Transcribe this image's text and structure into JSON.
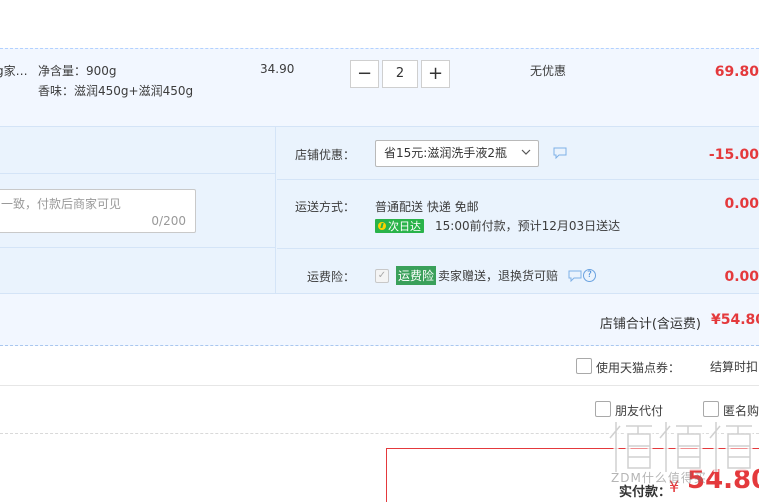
{
  "item": {
    "name_fragment": "g家…",
    "spec_net": "净含量：900g",
    "spec_scent": "香味：滋润450g+滋润450g",
    "price": "34.90",
    "qty_minus": "−",
    "quantity": "2",
    "qty_plus": "+",
    "promotion": "无优惠",
    "subtotal": "69.80"
  },
  "message": {
    "placeholder_fragment": "一致，付款后商家可见",
    "counter": "0/200"
  },
  "store_coupon": {
    "label": "店铺优惠：",
    "selected": "省15元:滋润洗手液2瓶",
    "amount": "-15.00"
  },
  "shipping": {
    "label": "运送方式：",
    "method": "普通配送 快递 免邮",
    "badge": "次日达",
    "eta": "15:00前付款，预计12月03日送达",
    "amount": "0.00"
  },
  "insurance": {
    "label": "运费险：",
    "tag": "运费险",
    "text": "卖家赠送，退换货可赔",
    "amount": "0.00"
  },
  "store_total": {
    "label": "店铺合计(含运费)",
    "value": "¥54.80"
  },
  "tmall_points": {
    "label": "使用天猫点券：",
    "right_fragment": "结算时扣"
  },
  "friend_pay": {
    "friend_label": "朋友代付",
    "anon_label": "匿名购"
  },
  "payment": {
    "label": "实付款：",
    "currency": "¥",
    "value": "54.80"
  },
  "watermark": {
    "text": "值值值",
    "site": "ZDM什么值得买"
  },
  "colors": {
    "accent_red": "#e4393c",
    "light_blue_bg": "#eaf3fd",
    "item_bg": "#f2f7ff",
    "nextday_green": "#2ab34a",
    "insurance_green": "#3aa05a"
  }
}
